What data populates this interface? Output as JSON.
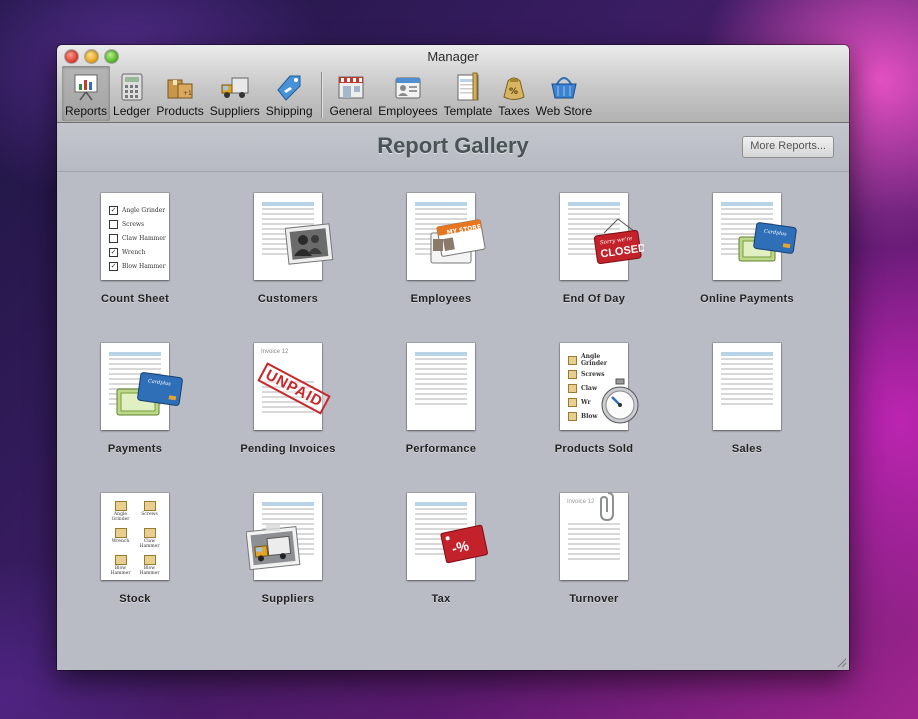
{
  "window": {
    "title": "Manager"
  },
  "toolbar": {
    "items": [
      {
        "label": "Reports",
        "icon": "reports-icon",
        "active": true
      },
      {
        "label": "Ledger",
        "icon": "ledger-icon"
      },
      {
        "label": "Products",
        "icon": "products-icon"
      },
      {
        "label": "Suppliers",
        "icon": "suppliers-icon"
      },
      {
        "label": "Shipping",
        "icon": "shipping-icon"
      },
      {
        "label": "General",
        "icon": "general-icon"
      },
      {
        "label": "Employees",
        "icon": "employees-icon"
      },
      {
        "label": "Template",
        "icon": "template-icon"
      },
      {
        "label": "Taxes",
        "icon": "taxes-icon"
      },
      {
        "label": "Web Store",
        "icon": "web-store-icon"
      }
    ]
  },
  "gallery": {
    "title": "Report Gallery",
    "more_button": "More Reports...",
    "reports": [
      {
        "label": "Count Sheet"
      },
      {
        "label": "Customers"
      },
      {
        "label": "Employees"
      },
      {
        "label": "End Of Day"
      },
      {
        "label": "Online Payments"
      },
      {
        "label": "Payments"
      },
      {
        "label": "Pending Invoices"
      },
      {
        "label": "Performance"
      },
      {
        "label": "Products Sold"
      },
      {
        "label": "Sales"
      },
      {
        "label": "Stock"
      },
      {
        "label": "Suppliers"
      },
      {
        "label": "Tax"
      },
      {
        "label": "Turnover"
      }
    ]
  },
  "thumbnails": {
    "count_sheet_items": [
      "Angle Grinder",
      "Screws",
      "Claw Hammer",
      "Wrench",
      "Blow Hammer"
    ],
    "count_sheet_checked": [
      true,
      false,
      false,
      true,
      true
    ],
    "products_sold_items": [
      "Angle Grinder",
      "Screws",
      "Claw",
      "Wr",
      "Blow"
    ],
    "stock_items": [
      "Angle Grinder",
      "Screws",
      "Wrench",
      "Claw Hammer",
      "Blow Hammer",
      "Blow Hammer"
    ],
    "invoice_heading": "Invoice 12",
    "unpaid_stamp": "UNPAID",
    "closed_sign_top": "Sorry we're",
    "closed_sign": "CLOSED",
    "my_store_badge": "MY STORE",
    "card_brand": "Cardplus",
    "tax_tag": "-%",
    "taxes_bag": "%"
  },
  "colors": {
    "window_bg": "#b9bcc4",
    "title_text": "#4a5356",
    "stamp_red": "#c8282b",
    "card_blue": "#2f6fb8",
    "table_header_blue": "#b9d3e6"
  }
}
